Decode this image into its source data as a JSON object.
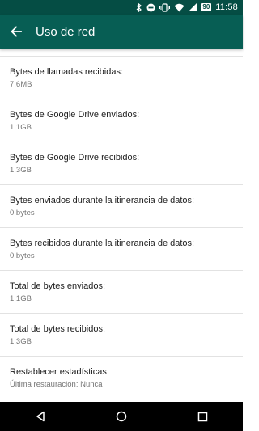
{
  "status_bar": {
    "time": "11:58",
    "battery_level": "90",
    "icons": [
      "bluetooth-icon",
      "do-not-disturb-icon",
      "vibrate-icon",
      "wifi-icon",
      "signal-icon",
      "battery-icon"
    ]
  },
  "app_bar": {
    "title": "Uso de red",
    "back_icon": "arrow-back-icon"
  },
  "items": [
    {
      "title": "Bytes de llamadas recibidas:",
      "value": "7,6MB"
    },
    {
      "title": "Bytes de Google Drive enviados:",
      "value": "1,1GB"
    },
    {
      "title": "Bytes de Google Drive recibidos:",
      "value": "1,3GB"
    },
    {
      "title": "Bytes enviados durante la itinerancia de datos:",
      "value": "0 bytes"
    },
    {
      "title": "Bytes recibidos durante la itinerancia de datos:",
      "value": "0 bytes"
    },
    {
      "title": "Total de bytes enviados:",
      "value": "1,1GB"
    },
    {
      "title": "Total de bytes recibidos:",
      "value": "1,3GB"
    },
    {
      "title": "Restablecer estadísticas",
      "value": "Última restauración: Nunca"
    }
  ],
  "nav_bar": {
    "icons": [
      "back-triangle-icon",
      "home-circle-icon",
      "recents-square-icon"
    ]
  },
  "colors": {
    "status_bar": "#054d44",
    "app_bar": "#075e54",
    "primary_text": "#212121",
    "secondary_text": "#757575",
    "divider": "#e2e2e2"
  }
}
